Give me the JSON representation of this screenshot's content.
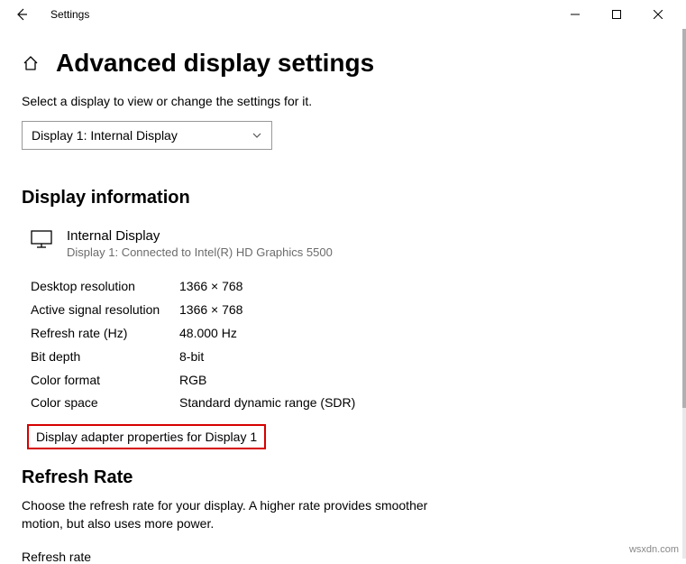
{
  "window": {
    "title": "Settings"
  },
  "page": {
    "title": "Advanced display settings",
    "intro": "Select a display to view or change the settings for it.",
    "selector_value": "Display 1: Internal Display"
  },
  "info": {
    "heading": "Display information",
    "display_name": "Internal Display",
    "display_sub": "Display 1: Connected to Intel(R) HD Graphics 5500",
    "specs": [
      {
        "label": "Desktop resolution",
        "value": "1366 × 768"
      },
      {
        "label": "Active signal resolution",
        "value": "1366 × 768"
      },
      {
        "label": "Refresh rate (Hz)",
        "value": "48.000 Hz"
      },
      {
        "label": "Bit depth",
        "value": "8-bit"
      },
      {
        "label": "Color format",
        "value": "RGB"
      },
      {
        "label": "Color space",
        "value": "Standard dynamic range (SDR)"
      }
    ],
    "adapter_link": "Display adapter properties for Display 1"
  },
  "refresh": {
    "heading": "Refresh Rate",
    "desc": "Choose the refresh rate for your display. A higher rate provides smoother motion, but also uses more power.",
    "label": "Refresh rate"
  },
  "watermark": "wsxdn.com"
}
